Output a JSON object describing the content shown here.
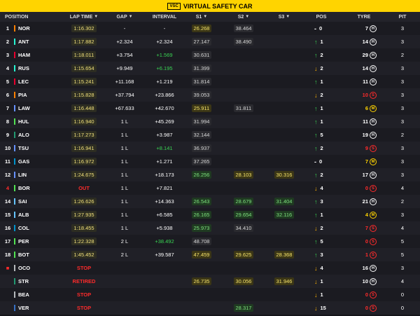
{
  "banner": {
    "badge": "VSC",
    "text": "VIRTUAL SAFETY CAR"
  },
  "header": {
    "position": "POSITION",
    "lap_time": "LAP TIME",
    "gap": "GAP",
    "interval": "INTERVAL",
    "s1": "S1",
    "s2": "S2",
    "s3": "S3",
    "pos": "POS",
    "tyre": "TYRE",
    "pit": "PIT"
  },
  "rows": [
    {
      "pos": "1",
      "driver": "NOR",
      "team_color": "#ff8000",
      "lap": "1:16.302",
      "gap": "-",
      "interval": "-",
      "s1": "26.268",
      "s1c": "s-yellow",
      "s2": "38.464",
      "s2c": "s-grey",
      "s3": "",
      "s3c": "",
      "change": "0",
      "dir": "-",
      "tyre_laps": "7",
      "tyre": "H",
      "tyre_red": false,
      "pit": "3"
    },
    {
      "pos": "2",
      "driver": "ANT",
      "team_color": "#27f4d2",
      "lap": "1:17.882",
      "gap": "+2.324",
      "interval": "+2.324",
      "s1": "27.147",
      "s1c": "s-grey",
      "s2": "38.490",
      "s2c": "s-grey",
      "s3": "",
      "s3c": "",
      "change": "1",
      "dir": "up",
      "tyre_laps": "14",
      "tyre": "H",
      "tyre_red": false,
      "pit": "3"
    },
    {
      "pos": "3",
      "driver": "HAM",
      "team_color": "#e8002d",
      "lap": "1:18.011",
      "gap": "+3.754",
      "interval": "+1.569",
      "int_green": true,
      "s1": "30.631",
      "s1c": "s-grey",
      "s2": "",
      "s2c": "",
      "s3": "",
      "s3c": "",
      "change": "2",
      "dir": "up",
      "tyre_laps": "29",
      "tyre": "H",
      "tyre_red": false,
      "pit": "2"
    },
    {
      "pos": "4",
      "driver": "RUS",
      "team_color": "#27f4d2",
      "lap": "1:15.654",
      "gap": "+9.949",
      "interval": "+6.195",
      "int_green": true,
      "s1": "31.399",
      "s1c": "s-grey",
      "s2": "",
      "s2c": "",
      "s3": "",
      "s3c": "",
      "change": "2",
      "dir": "down",
      "tyre_laps": "14",
      "tyre": "H",
      "tyre_red": false,
      "pit": "3"
    },
    {
      "pos": "5",
      "driver": "LEC",
      "team_color": "#e8002d",
      "lap": "1:15.241",
      "gap": "+11.168",
      "interval": "+1.219",
      "s1": "31.814",
      "s1c": "s-grey",
      "s2": "",
      "s2c": "",
      "s3": "",
      "s3c": "",
      "change": "1",
      "dir": "up",
      "tyre_laps": "11",
      "tyre": "H",
      "tyre_red": false,
      "pit": "3"
    },
    {
      "pos": "6",
      "driver": "PIA",
      "team_color": "#ff8000",
      "lap": "1:15.828",
      "gap": "+37.794",
      "interval": "+23.866",
      "s1": "39.053",
      "s1c": "s-grey",
      "s2": "",
      "s2c": "",
      "s3": "",
      "s3c": "",
      "change": "2",
      "dir": "down",
      "tyre_laps": "10",
      "tyre_laps_red": true,
      "tyre": "S",
      "tyre_red": true,
      "pit": "3"
    },
    {
      "pos": "7",
      "driver": "LAW",
      "team_color": "#6692ff",
      "lap": "1:16.448",
      "gap": "+67.633",
      "interval": "+42.670",
      "s1": "25.911",
      "s1c": "s-yellow",
      "s2": "31.811",
      "s2c": "s-grey",
      "s3": "",
      "s3c": "",
      "change": "1",
      "dir": "up",
      "tyre_laps": "6",
      "tyre_laps_yellow": true,
      "tyre": "M",
      "tyre_red": false,
      "pit": "3"
    },
    {
      "pos": "8",
      "driver": "HUL",
      "team_color": "#52e252",
      "lap": "1:16.940",
      "gap": "1 L",
      "interval": "+45.269",
      "s1": "31.994",
      "s1c": "s-grey",
      "s2": "",
      "s2c": "",
      "s3": "",
      "s3c": "",
      "change": "1",
      "dir": "up",
      "tyre_laps": "11",
      "tyre": "H",
      "tyre_red": false,
      "pit": "3"
    },
    {
      "pos": "9",
      "driver": "ALO",
      "team_color": "#229971",
      "lap": "1:17.273",
      "gap": "1 L",
      "interval": "+3.987",
      "s1": "32.144",
      "s1c": "s-grey",
      "s2": "",
      "s2c": "",
      "s3": "",
      "s3c": "",
      "change": "5",
      "dir": "up",
      "tyre_laps": "19",
      "tyre": "H",
      "tyre_red": false,
      "pit": "2"
    },
    {
      "pos": "10",
      "driver": "TSU",
      "team_color": "#6692ff",
      "lap": "1:16.941",
      "gap": "1 L",
      "interval": "+8.141",
      "int_green": true,
      "s1": "36.937",
      "s1c": "s-grey",
      "s2": "",
      "s2c": "",
      "s3": "",
      "s3c": "",
      "change": "2",
      "dir": "up",
      "tyre_laps": "9",
      "tyre_laps_red": true,
      "tyre": "S",
      "tyre_red": true,
      "pit": "3"
    },
    {
      "pos": "11",
      "driver": "GAS",
      "team_color": "#0093cc",
      "lap": "1:16.972",
      "gap": "1 L",
      "interval": "+1.271",
      "s1": "37.265",
      "s1c": "s-grey",
      "s2": "",
      "s2c": "",
      "s3": "",
      "s3c": "",
      "change": "0",
      "dir": "-",
      "tyre_laps": "7",
      "tyre_laps_yellow": true,
      "tyre": "M",
      "tyre_red": false,
      "pit": "3"
    },
    {
      "pos": "12",
      "driver": "LIN",
      "team_color": "#6692ff",
      "lap": "1:24.675",
      "gap": "1 L",
      "interval": "+18.173",
      "s1": "26.256",
      "s1c": "s-green",
      "s2": "28.103",
      "s2c": "s-yellow",
      "s3": "30.316",
      "s3c": "s-yellow",
      "change": "2",
      "dir": "up",
      "tyre_laps": "17",
      "tyre": "H",
      "tyre_red": false,
      "pit": "3"
    },
    {
      "pos": "4",
      "pos_red": true,
      "driver": "BOR",
      "team_color": "#52e252",
      "lap": "OUT",
      "lap_red": true,
      "gap": "1 L",
      "interval": "+7.821",
      "s1": "",
      "s1c": "",
      "s2": "",
      "s2c": "",
      "s3": "",
      "s3c": "",
      "change": "4",
      "dir": "down",
      "tyre_laps": "0",
      "tyre_laps_red": true,
      "tyre": "S",
      "tyre_red": true,
      "pit": "4"
    },
    {
      "pos": "14",
      "driver": "SAI",
      "team_color": "#64c4ff",
      "lap": "1:26.626",
      "gap": "1 L",
      "interval": "+14.363",
      "s1": "26.543",
      "s1c": "s-green",
      "s2": "28.679",
      "s2c": "s-green",
      "s3": "31.404",
      "s3c": "s-green",
      "change": "3",
      "dir": "up",
      "tyre_laps": "21",
      "tyre": "H",
      "tyre_red": false,
      "pit": "2"
    },
    {
      "pos": "15",
      "driver": "ALB",
      "team_color": "#64c4ff",
      "lap": "1:27.935",
      "gap": "1 L",
      "interval": "+6.585",
      "s1": "26.165",
      "s1c": "s-green",
      "s2": "29.654",
      "s2c": "s-green",
      "s3": "32.116",
      "s3c": "s-green",
      "change": "1",
      "dir": "up",
      "tyre_laps": "4",
      "tyre_laps_yellow": true,
      "tyre": "M",
      "tyre_red": false,
      "pit": "3"
    },
    {
      "pos": "16",
      "driver": "COL",
      "team_color": "#0093cc",
      "lap": "1:18.455",
      "gap": "1 L",
      "interval": "+5.938",
      "s1": "25.973",
      "s1c": "s-green",
      "s2": "34.410",
      "s2c": "s-grey",
      "s3": "",
      "s3c": "",
      "change": "2",
      "dir": "down",
      "tyre_laps": "7",
      "tyre_laps_red": true,
      "tyre": "S",
      "tyre_red": true,
      "pit": "4"
    },
    {
      "pos": "17",
      "driver": "PER",
      "team_color": "#52e252",
      "lap": "1:22.328",
      "gap": "2 L",
      "interval": "+38.492",
      "int_green": true,
      "s1": "48.708",
      "s1c": "s-grey",
      "s2": "",
      "s2c": "",
      "s3": "",
      "s3c": "",
      "change": "5",
      "dir": "up",
      "tyre_laps": "0",
      "tyre_laps_red": true,
      "tyre": "S",
      "tyre_red": true,
      "pit": "5"
    },
    {
      "pos": "18",
      "driver": "BOT",
      "team_color": "#52e252",
      "lap": "1:45.452",
      "gap": "2 L",
      "interval": "+39.587",
      "s1": "47.459",
      "s1c": "s-yellow",
      "s2": "29.625",
      "s2c": "s-yellow",
      "s3": "28.368",
      "s3c": "s-yellow",
      "change": "3",
      "dir": "up",
      "tyre_laps": "1",
      "tyre_laps_red": true,
      "tyre": "S",
      "tyre_red": true,
      "pit": "5"
    },
    {
      "pos": "■",
      "pos_red": true,
      "driver": "OCO",
      "team_color": "#b6babd",
      "lap": "STOP",
      "lap_red": true,
      "gap": "",
      "interval": "",
      "s1": "",
      "s1c": "",
      "s2": "",
      "s2c": "",
      "s3": "",
      "s3c": "",
      "change": "4",
      "dir": "down",
      "tyre_laps": "16",
      "tyre": "H",
      "tyre_red": false,
      "pit": "3"
    },
    {
      "pos": "",
      "driver": "STR",
      "team_color": "#229971",
      "lap": "RETIRED",
      "lap_red": true,
      "gap": "",
      "interval": "",
      "s1": "26.735",
      "s1c": "s-yellow",
      "s2": "30.056",
      "s2c": "s-yellow",
      "s3": "31.946",
      "s3c": "s-yellow",
      "change": "1",
      "dir": "down",
      "tyre_laps": "10",
      "tyre": "H",
      "tyre_red": false,
      "pit": "4"
    },
    {
      "pos": "",
      "driver": "BEA",
      "team_color": "#b6babd",
      "lap": "STOP",
      "lap_red": true,
      "gap": "",
      "interval": "",
      "s1": "",
      "s1c": "",
      "s2": "",
      "s2c": "",
      "s3": "",
      "s3c": "",
      "change": "1",
      "dir": "down",
      "tyre_laps": "0",
      "tyre_laps_red": true,
      "tyre": "S",
      "tyre_red": true,
      "pit": "0"
    },
    {
      "pos": "",
      "driver": "VER",
      "team_color": "#3671c6",
      "lap": "STOP",
      "lap_red": true,
      "gap": "",
      "interval": "",
      "s1": "",
      "s1c": "",
      "s2": "28.317",
      "s2c": "s-green",
      "s3": "",
      "s3c": "",
      "change": "15",
      "dir": "down",
      "tyre_laps": "0",
      "tyre_laps_red": true,
      "tyre": "S",
      "tyre_red": true,
      "pit": "0"
    }
  ]
}
